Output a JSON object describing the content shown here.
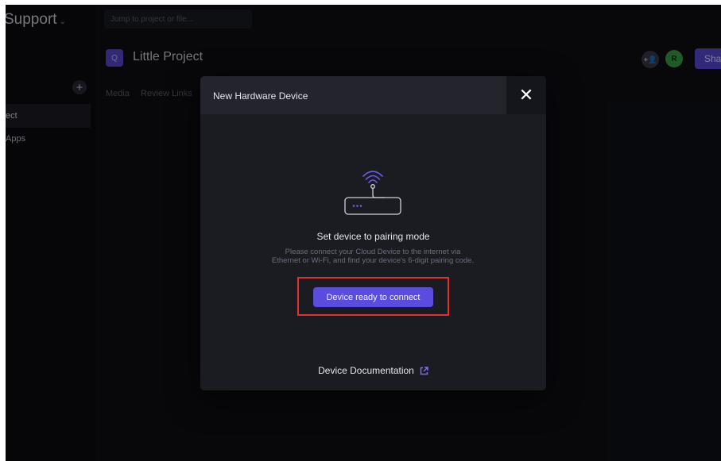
{
  "sidebar": {
    "workspace_name": "Support",
    "add_icon": "+",
    "items": [
      {
        "label": "ect",
        "active": true
      },
      {
        "label": "Apps",
        "active": false
      }
    ]
  },
  "topbar": {
    "search_placeholder": "Jump to project or file...",
    "project_icon": "Q",
    "project_title": "Little Project",
    "invite_icon": "+👤",
    "avatar_initial": "R",
    "share_label": "Sha"
  },
  "tabs": [
    {
      "label": "Media"
    },
    {
      "label": "Review Links"
    }
  ],
  "modal": {
    "title": "New Hardware Device",
    "close_icon": "✕",
    "illustration_icon": "router-wifi-icon",
    "step_title": "Set device to pairing mode",
    "description": "Please connect your Cloud Device to the internet via Ethernet or Wi-Fi, and find your device's 6-digit pairing code.",
    "primary_button": "Device ready to connect",
    "doc_link": "Device Documentation",
    "doc_link_icon": "external-link-icon"
  },
  "colors": {
    "accent": "#5b4ce0",
    "highlight": "#e0322e",
    "avatar": "#3aa64a"
  }
}
